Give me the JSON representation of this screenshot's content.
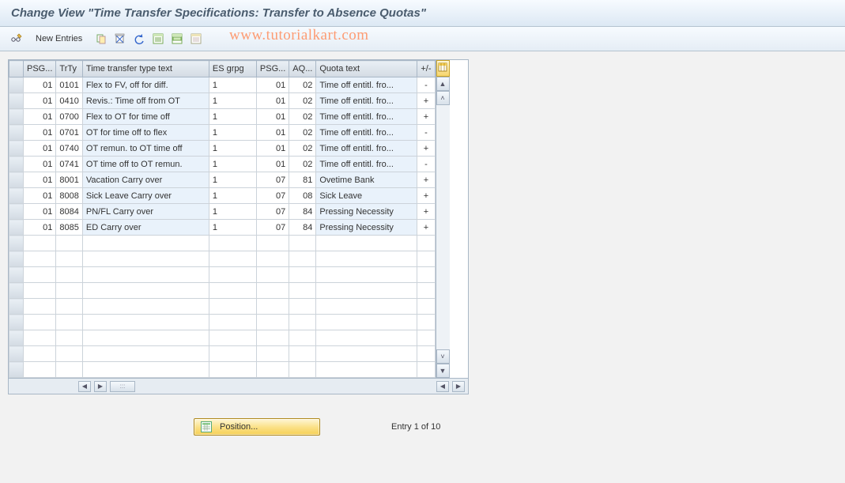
{
  "title": "Change View \"Time Transfer Specifications: Transfer to Absence Quotas\"",
  "watermark": "www.tutorialkart.com",
  "toolbar": {
    "new_entries": "New Entries"
  },
  "table": {
    "headers": {
      "rowsel": "",
      "psg": "PSG...",
      "trty": "TrTy",
      "txt": "Time transfer type text",
      "es": "ES grpg",
      "psg2": "PSG...",
      "aq": "AQ...",
      "qt": "Quota text",
      "pm": "+/-"
    },
    "rows": [
      {
        "psg": "01",
        "trty": "0101",
        "txt": "Flex to FV, off for diff.",
        "es": "1",
        "psg2": "01",
        "aq": "02",
        "qt": "Time off entitl. fro...",
        "pm": "-"
      },
      {
        "psg": "01",
        "trty": "0410",
        "txt": "Revis.: Time off from OT",
        "es": "1",
        "psg2": "01",
        "aq": "02",
        "qt": "Time off entitl. fro...",
        "pm": "+"
      },
      {
        "psg": "01",
        "trty": "0700",
        "txt": "Flex to OT for time off",
        "es": "1",
        "psg2": "01",
        "aq": "02",
        "qt": "Time off entitl. fro...",
        "pm": "+"
      },
      {
        "psg": "01",
        "trty": "0701",
        "txt": "OT for time off to flex",
        "es": "1",
        "psg2": "01",
        "aq": "02",
        "qt": "Time off entitl. fro...",
        "pm": "-"
      },
      {
        "psg": "01",
        "trty": "0740",
        "txt": "OT remun. to OT time off",
        "es": "1",
        "psg2": "01",
        "aq": "02",
        "qt": "Time off entitl. fro...",
        "pm": "+"
      },
      {
        "psg": "01",
        "trty": "0741",
        "txt": "OT time off to OT remun.",
        "es": "1",
        "psg2": "01",
        "aq": "02",
        "qt": "Time off entitl. fro...",
        "pm": "-"
      },
      {
        "psg": "01",
        "trty": "8001",
        "txt": "Vacation Carry over",
        "es": "1",
        "psg2": "07",
        "aq": "81",
        "qt": "Ovetime Bank",
        "pm": "+"
      },
      {
        "psg": "01",
        "trty": "8008",
        "txt": "Sick Leave Carry over",
        "es": "1",
        "psg2": "07",
        "aq": "08",
        "qt": "Sick Leave",
        "pm": "+"
      },
      {
        "psg": "01",
        "trty": "8084",
        "txt": "PN/FL Carry over",
        "es": "1",
        "psg2": "07",
        "aq": "84",
        "qt": "Pressing Necessity",
        "pm": "+"
      },
      {
        "psg": "01",
        "trty": "8085",
        "txt": "ED Carry over",
        "es": "1",
        "psg2": "07",
        "aq": "84",
        "qt": "Pressing Necessity",
        "pm": "+"
      }
    ],
    "empty_rows": 9
  },
  "footer": {
    "position_label": "Position...",
    "entry_text": "Entry 1 of 10"
  }
}
